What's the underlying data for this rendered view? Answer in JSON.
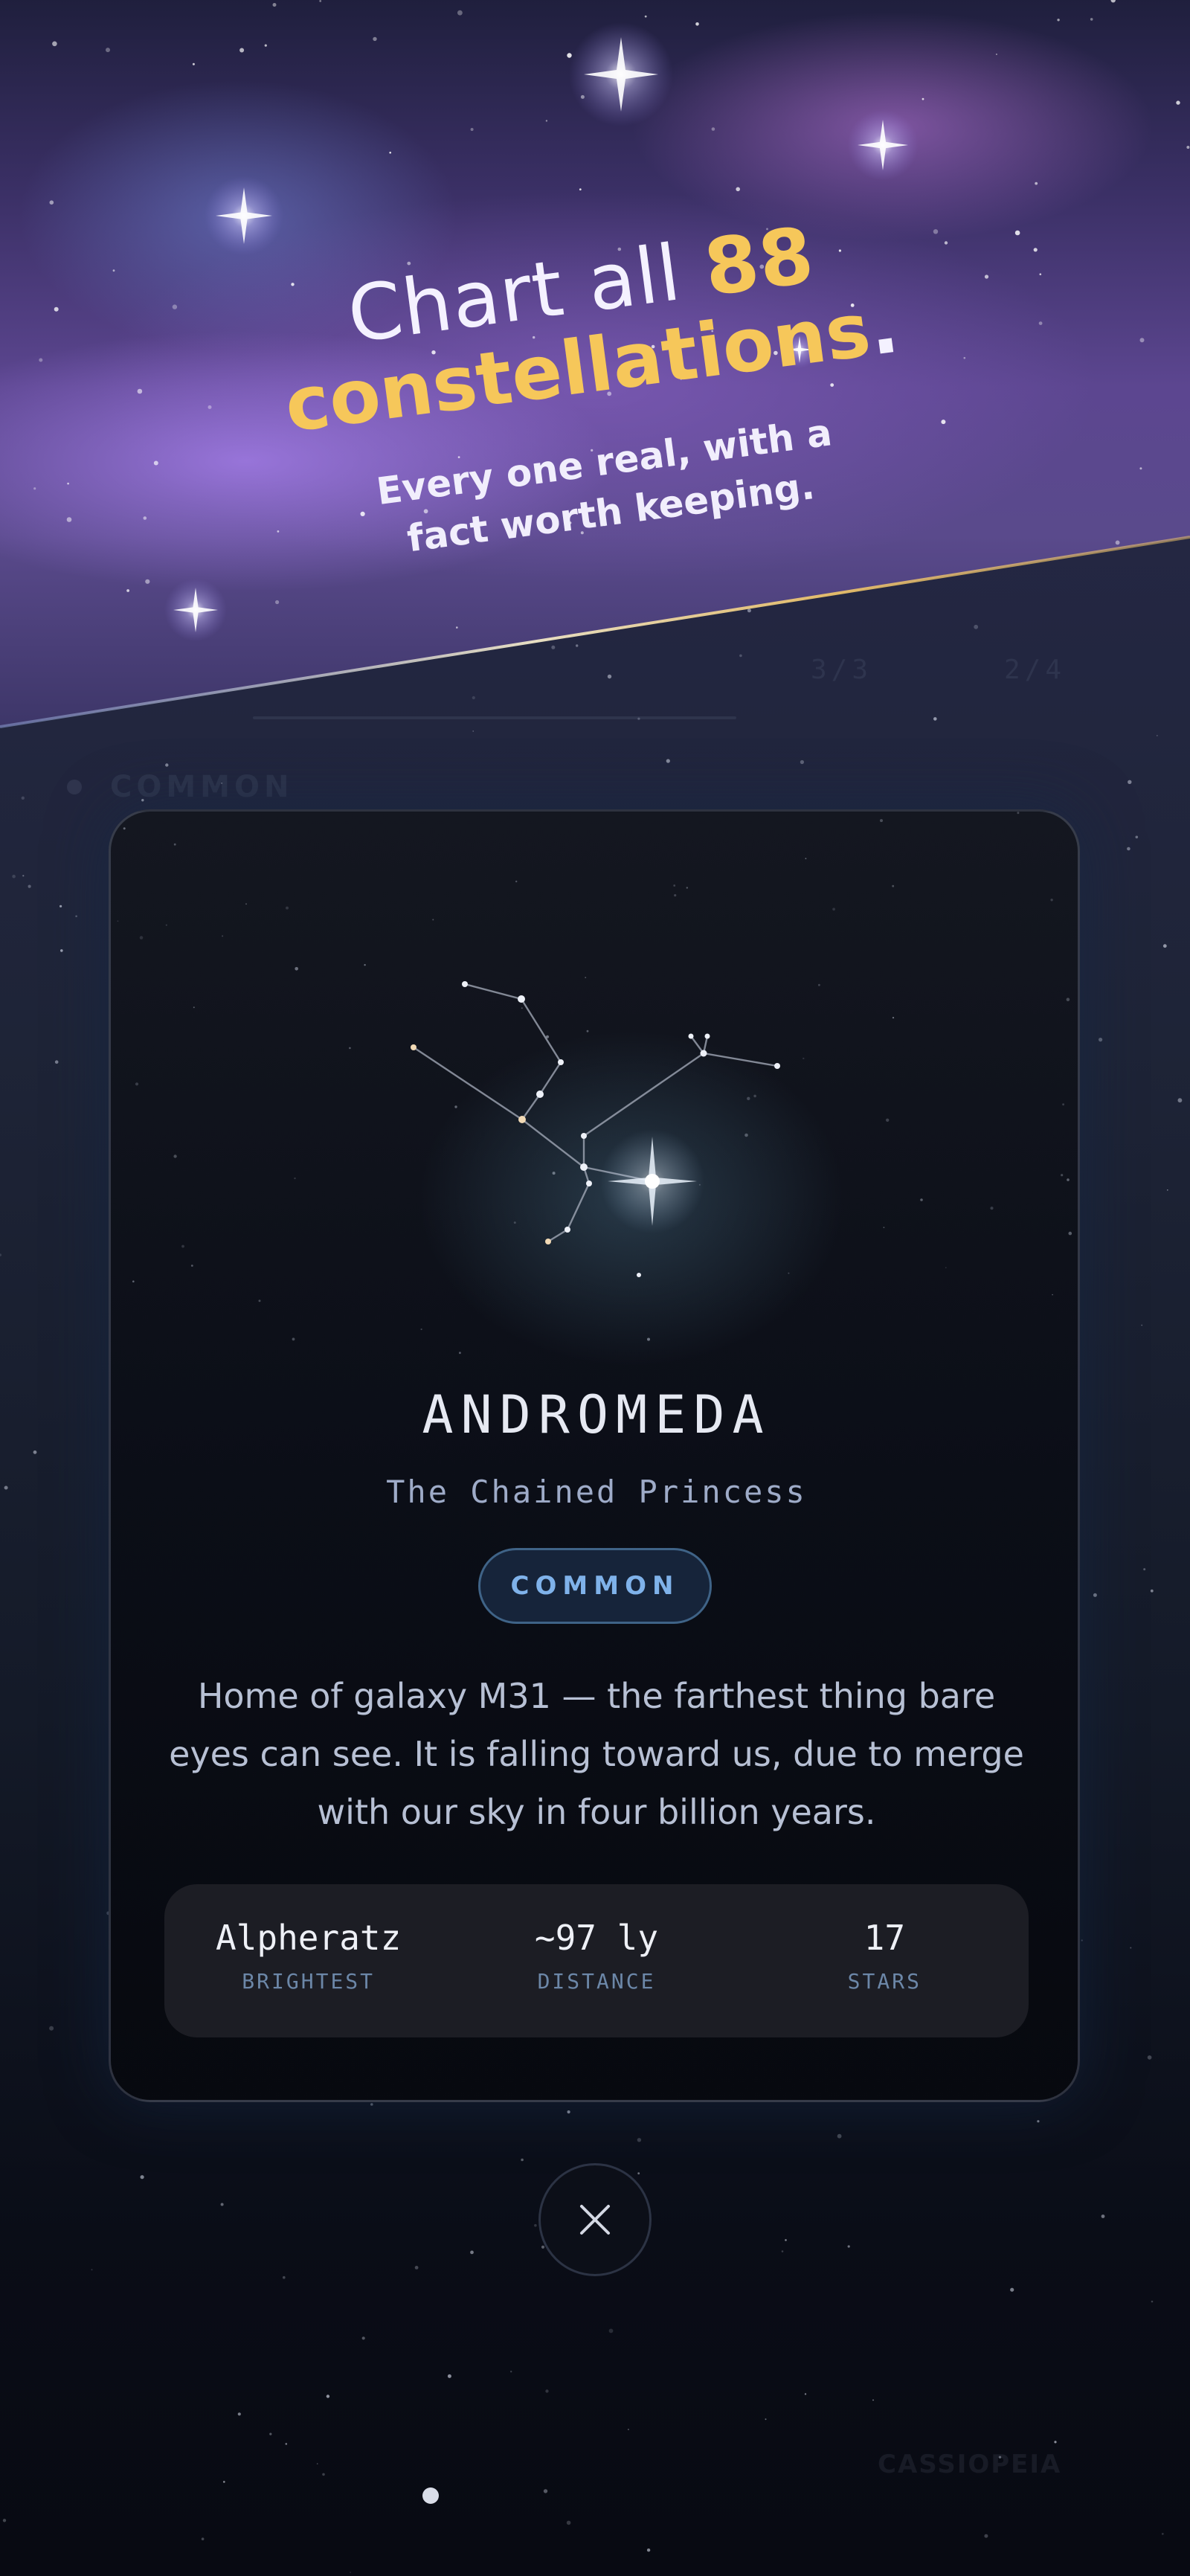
{
  "headline": {
    "line1_prefix": "Chart all ",
    "line1_number": "88",
    "line2_word": "constellations",
    "line2_period": ".",
    "subhead_line1": "Every one real, with a",
    "subhead_line2": "fact worth keeping."
  },
  "card": {
    "name": "ANDROMEDA",
    "subtitle": "The Chained Princess",
    "rarity": "COMMON",
    "description": "Home of galaxy M31 — the farthest thing bare eyes can see. It is falling toward us, due to merge with our sky in four billion years.",
    "stats": [
      {
        "value": "Alpheratz",
        "label": "BRIGHTEST"
      },
      {
        "value": "~97 ly",
        "label": "DISTANCE"
      },
      {
        "value": "17",
        "label": "STARS"
      }
    ]
  },
  "background": {
    "counter_a": "3/3",
    "counter_b": "2/4",
    "section_label": "COMMON",
    "tile_label": "CASSIOPEIA"
  },
  "icons": {
    "close": "close-icon",
    "constellation": "andromeda-constellation-icon"
  },
  "colors": {
    "accent_gold": "#f6c75a",
    "rarity_blue": "#7fb2ea",
    "stat_label": "#6c87a8"
  }
}
